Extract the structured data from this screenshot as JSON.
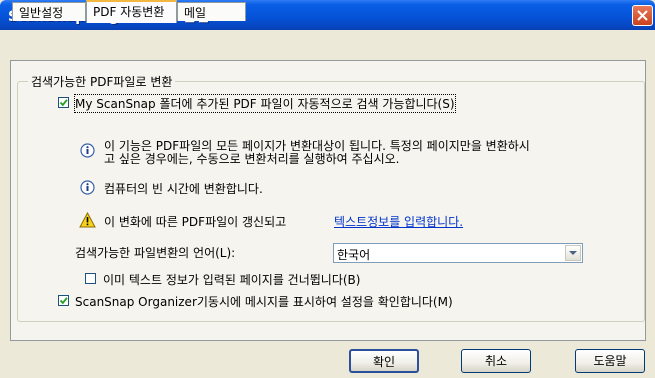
{
  "window": {
    "title": "ScanSnap Organizer - 옵션"
  },
  "tabs": [
    {
      "label": "일반설정"
    },
    {
      "label": "PDF 자동변환",
      "active": true
    },
    {
      "label": "메일"
    }
  ],
  "group": {
    "legend": "검색가능한 PDF파일로 변환"
  },
  "auto_convert": {
    "label": "My ScanSnap 폴더에 추가된 PDF 파일이 자동적으로 검색 가능합니다(S)",
    "checked": true
  },
  "info1": {
    "line1": "이 기능은 PDF파일의 모든 페이지가 변환대상이 됩니다. 특정의 페이지만을 변환하시",
    "line2": "고 싶은 경우에는, 수동으로 변환처리를 실행하여 주십시오."
  },
  "info2": {
    "text": "컴퓨터의 빈 시간에 변환합니다."
  },
  "warning": {
    "text": "이 변화에 따른 PDF파일이 갱신되고",
    "link": "텍스트정보를 입력합니다."
  },
  "language": {
    "label": "검색가능한 파일변환의 언어(L):",
    "selected": "한국어"
  },
  "skip_pages": {
    "label": "이미 텍스트 정보가 입력된 페이지를 건너뜁니다(B)",
    "checked": false
  },
  "show_message": {
    "label": "ScanSnap Organizer기동시에 메시지를 표시하여 설정을 확인합니다(M)",
    "checked": true
  },
  "buttons": {
    "ok": "확인",
    "cancel": "취소",
    "help": "도움말"
  }
}
